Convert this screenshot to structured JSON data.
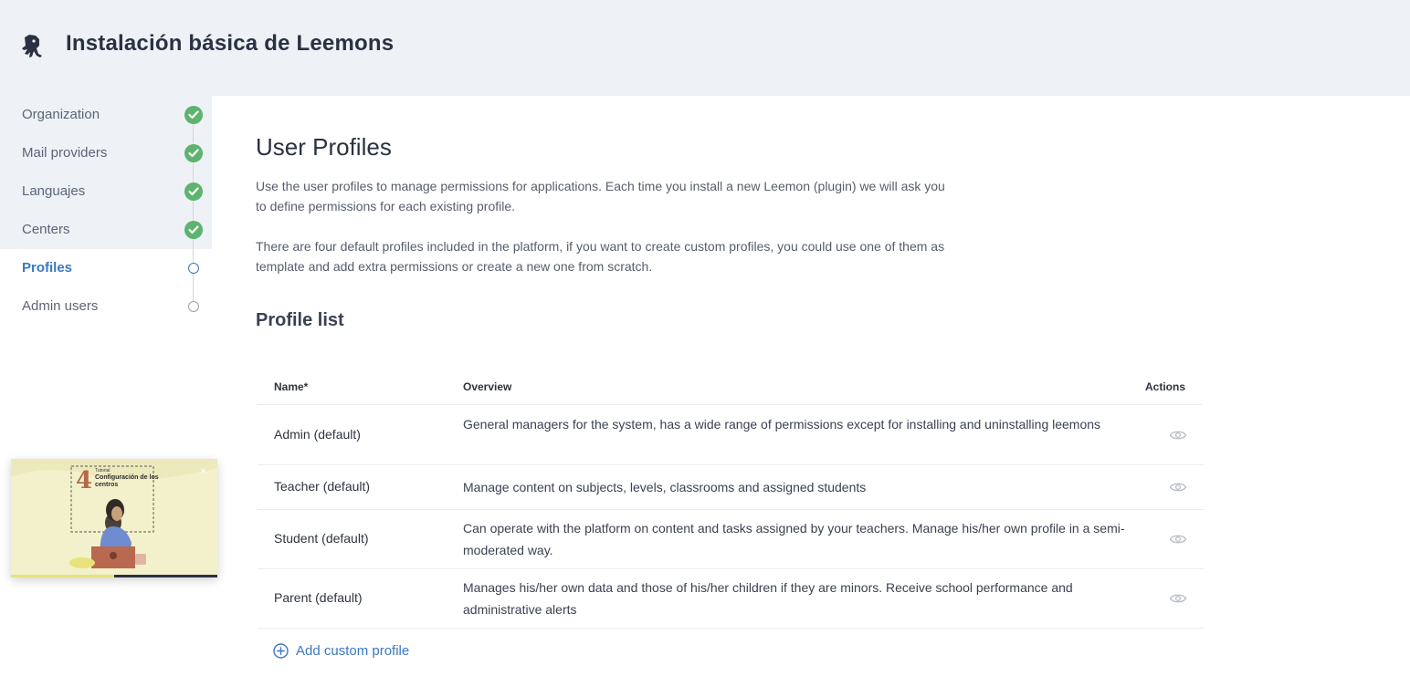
{
  "app": {
    "title": "Instalación básica de Leemons",
    "logo_icon": "octopus-logo-icon"
  },
  "sidebar": {
    "items": [
      {
        "label": "Organization",
        "state": "done"
      },
      {
        "label": "Mail providers",
        "state": "done"
      },
      {
        "label": "Languajes",
        "state": "done"
      },
      {
        "label": "Centers",
        "state": "done"
      },
      {
        "label": "Profiles",
        "state": "active"
      },
      {
        "label": "Admin users",
        "state": "pending"
      }
    ]
  },
  "main": {
    "title": "User Profiles",
    "description_1": "Use the user profiles to manage permissions for applications. Each time you install a new Leemon (plugin) we will ask you to define permissions for each existing profile.",
    "description_2": "There are four default profiles included in the platform, if you want to create custom profiles, you could use one of them as template and add extra permissions or create a new one from scratch.",
    "section_title": "Profile list"
  },
  "table": {
    "columns": {
      "name": "Name*",
      "overview": "Overview",
      "actions": "Actions"
    },
    "rows": [
      {
        "name": "Admin (default)",
        "overview": "General managers for the system, has a wide range of permissions except for installing and uninstalling leemons",
        "action_icon": "eye-icon"
      },
      {
        "name": "Teacher (default)",
        "overview": "Manage content on subjects, levels, classrooms and assigned students",
        "action_icon": "eye-icon"
      },
      {
        "name": "Student (default)",
        "overview": "Can operate with the platform on content and tasks assigned by your teachers. Manage his/her own profile in a semi-moderated way.",
        "action_icon": "eye-icon"
      },
      {
        "name": "Parent (default)",
        "overview": "Manages his/her own data and those of his/her children if they are minors. Receive school performance and administrative alerts",
        "action_icon": "eye-icon"
      }
    ],
    "add_label": "Add custom profile"
  },
  "video": {
    "number": "4",
    "small_label": "Tutorial",
    "title": "Configuración de los centros",
    "close": "×",
    "progress": 0.5
  },
  "colors": {
    "accent": "#3a78c2",
    "done": "#5cb46e",
    "header_bg": "#eef2f6"
  }
}
